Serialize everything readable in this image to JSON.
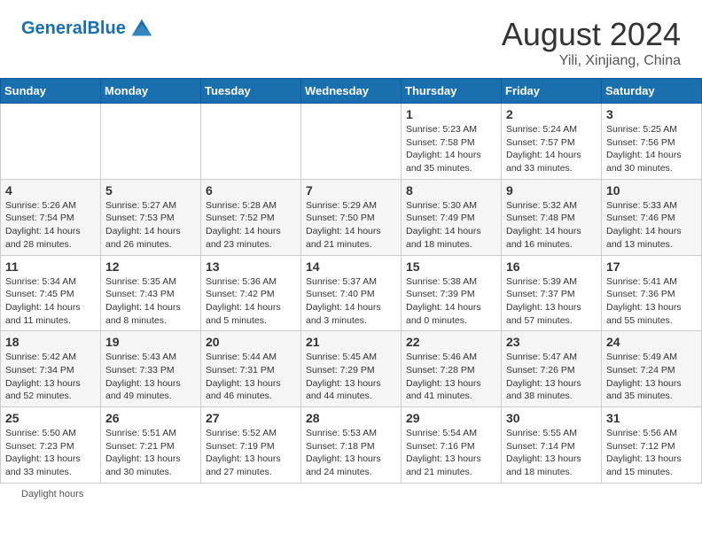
{
  "header": {
    "logo_text_general": "General",
    "logo_text_blue": "Blue",
    "month_title": "August 2024",
    "location": "Yili, Xinjiang, China"
  },
  "calendar": {
    "days_of_week": [
      "Sunday",
      "Monday",
      "Tuesday",
      "Wednesday",
      "Thursday",
      "Friday",
      "Saturday"
    ],
    "weeks": [
      [
        {
          "day": "",
          "info": ""
        },
        {
          "day": "",
          "info": ""
        },
        {
          "day": "",
          "info": ""
        },
        {
          "day": "",
          "info": ""
        },
        {
          "day": "1",
          "info": "Sunrise: 5:23 AM\nSunset: 7:58 PM\nDaylight: 14 hours\nand 35 minutes."
        },
        {
          "day": "2",
          "info": "Sunrise: 5:24 AM\nSunset: 7:57 PM\nDaylight: 14 hours\nand 33 minutes."
        },
        {
          "day": "3",
          "info": "Sunrise: 5:25 AM\nSunset: 7:56 PM\nDaylight: 14 hours\nand 30 minutes."
        }
      ],
      [
        {
          "day": "4",
          "info": "Sunrise: 5:26 AM\nSunset: 7:54 PM\nDaylight: 14 hours\nand 28 minutes."
        },
        {
          "day": "5",
          "info": "Sunrise: 5:27 AM\nSunset: 7:53 PM\nDaylight: 14 hours\nand 26 minutes."
        },
        {
          "day": "6",
          "info": "Sunrise: 5:28 AM\nSunset: 7:52 PM\nDaylight: 14 hours\nand 23 minutes."
        },
        {
          "day": "7",
          "info": "Sunrise: 5:29 AM\nSunset: 7:50 PM\nDaylight: 14 hours\nand 21 minutes."
        },
        {
          "day": "8",
          "info": "Sunrise: 5:30 AM\nSunset: 7:49 PM\nDaylight: 14 hours\nand 18 minutes."
        },
        {
          "day": "9",
          "info": "Sunrise: 5:32 AM\nSunset: 7:48 PM\nDaylight: 14 hours\nand 16 minutes."
        },
        {
          "day": "10",
          "info": "Sunrise: 5:33 AM\nSunset: 7:46 PM\nDaylight: 14 hours\nand 13 minutes."
        }
      ],
      [
        {
          "day": "11",
          "info": "Sunrise: 5:34 AM\nSunset: 7:45 PM\nDaylight: 14 hours\nand 11 minutes."
        },
        {
          "day": "12",
          "info": "Sunrise: 5:35 AM\nSunset: 7:43 PM\nDaylight: 14 hours\nand 8 minutes."
        },
        {
          "day": "13",
          "info": "Sunrise: 5:36 AM\nSunset: 7:42 PM\nDaylight: 14 hours\nand 5 minutes."
        },
        {
          "day": "14",
          "info": "Sunrise: 5:37 AM\nSunset: 7:40 PM\nDaylight: 14 hours\nand 3 minutes."
        },
        {
          "day": "15",
          "info": "Sunrise: 5:38 AM\nSunset: 7:39 PM\nDaylight: 14 hours\nand 0 minutes."
        },
        {
          "day": "16",
          "info": "Sunrise: 5:39 AM\nSunset: 7:37 PM\nDaylight: 13 hours\nand 57 minutes."
        },
        {
          "day": "17",
          "info": "Sunrise: 5:41 AM\nSunset: 7:36 PM\nDaylight: 13 hours\nand 55 minutes."
        }
      ],
      [
        {
          "day": "18",
          "info": "Sunrise: 5:42 AM\nSunset: 7:34 PM\nDaylight: 13 hours\nand 52 minutes."
        },
        {
          "day": "19",
          "info": "Sunrise: 5:43 AM\nSunset: 7:33 PM\nDaylight: 13 hours\nand 49 minutes."
        },
        {
          "day": "20",
          "info": "Sunrise: 5:44 AM\nSunset: 7:31 PM\nDaylight: 13 hours\nand 46 minutes."
        },
        {
          "day": "21",
          "info": "Sunrise: 5:45 AM\nSunset: 7:29 PM\nDaylight: 13 hours\nand 44 minutes."
        },
        {
          "day": "22",
          "info": "Sunrise: 5:46 AM\nSunset: 7:28 PM\nDaylight: 13 hours\nand 41 minutes."
        },
        {
          "day": "23",
          "info": "Sunrise: 5:47 AM\nSunset: 7:26 PM\nDaylight: 13 hours\nand 38 minutes."
        },
        {
          "day": "24",
          "info": "Sunrise: 5:49 AM\nSunset: 7:24 PM\nDaylight: 13 hours\nand 35 minutes."
        }
      ],
      [
        {
          "day": "25",
          "info": "Sunrise: 5:50 AM\nSunset: 7:23 PM\nDaylight: 13 hours\nand 33 minutes."
        },
        {
          "day": "26",
          "info": "Sunrise: 5:51 AM\nSunset: 7:21 PM\nDaylight: 13 hours\nand 30 minutes."
        },
        {
          "day": "27",
          "info": "Sunrise: 5:52 AM\nSunset: 7:19 PM\nDaylight: 13 hours\nand 27 minutes."
        },
        {
          "day": "28",
          "info": "Sunrise: 5:53 AM\nSunset: 7:18 PM\nDaylight: 13 hours\nand 24 minutes."
        },
        {
          "day": "29",
          "info": "Sunrise: 5:54 AM\nSunset: 7:16 PM\nDaylight: 13 hours\nand 21 minutes."
        },
        {
          "day": "30",
          "info": "Sunrise: 5:55 AM\nSunset: 7:14 PM\nDaylight: 13 hours\nand 18 minutes."
        },
        {
          "day": "31",
          "info": "Sunrise: 5:56 AM\nSunset: 7:12 PM\nDaylight: 13 hours\nand 15 minutes."
        }
      ]
    ]
  },
  "footer": {
    "daylight_label": "Daylight hours"
  },
  "colors": {
    "header_bg": "#1a6faf",
    "logo_blue": "#1a6faf"
  }
}
